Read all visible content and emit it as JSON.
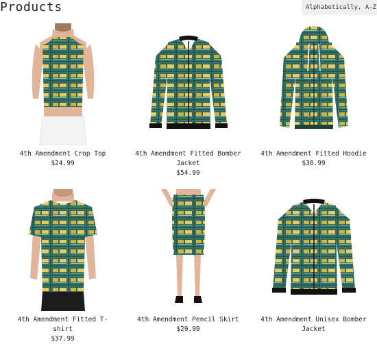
{
  "page": {
    "title": "Products"
  },
  "sort": {
    "selected": "Alphabetically, A-Z"
  },
  "colors": {
    "fabric": "#1e4a44",
    "plate": "#2f6b5e",
    "plate_text": "#d9b84a",
    "skin": "#e2b49a"
  },
  "products": [
    {
      "name": "4th Amendment Crop Top",
      "price": "$24.99"
    },
    {
      "name": "4th Amendment Fitted Bomber Jacket",
      "price": "$54.99"
    },
    {
      "name": "4th Amendment Fitted Hoodie",
      "price": "$38.99"
    },
    {
      "name": "4th Amendment Fitted T-shirt",
      "price": "$37.99"
    },
    {
      "name": "4th Amendment Pencil Skirt",
      "price": "$29.99"
    },
    {
      "name": "4th Amendment Unisex Bomber Jacket",
      "price": ""
    }
  ]
}
